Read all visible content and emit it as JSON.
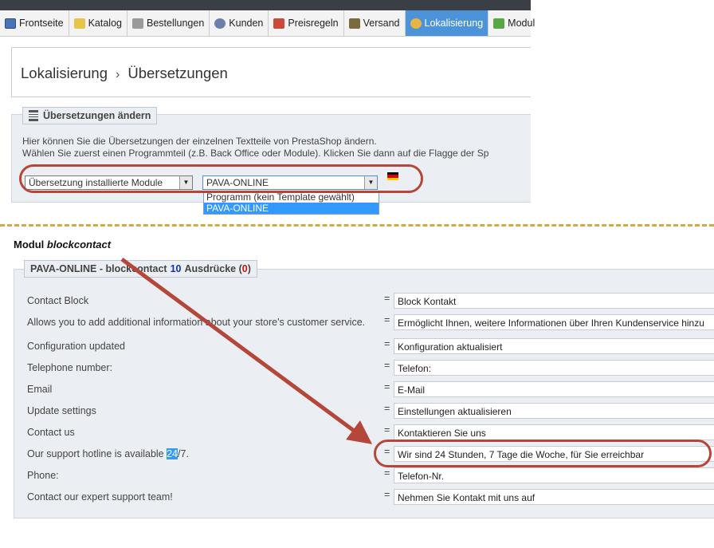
{
  "nav": {
    "tabs": [
      {
        "label": "Frontseite",
        "icon": "home-icon",
        "color": "#4a74b5"
      },
      {
        "label": "Katalog",
        "icon": "folder-icon",
        "color": "#e8c44a"
      },
      {
        "label": "Bestellungen",
        "icon": "cart-icon",
        "color": "#8a8a8a"
      },
      {
        "label": "Kunden",
        "icon": "user-icon",
        "color": "#6b7fae"
      },
      {
        "label": "Preisregeln",
        "icon": "price-tag-icon",
        "color": "#c94a3a"
      },
      {
        "label": "Versand",
        "icon": "truck-icon",
        "color": "#7a6a40"
      },
      {
        "label": "Lokalisierung",
        "icon": "globe-icon",
        "color": "#e6b640",
        "active": true
      },
      {
        "label": "Modul",
        "icon": "puzzle-icon",
        "color": "#55a845"
      }
    ]
  },
  "breadcrumb": {
    "parent": "Lokalisierung",
    "separator": "›",
    "current": "Übersetzungen"
  },
  "translations_panel": {
    "legend": "Übersetzungen ändern",
    "description_line1": "Hier können Sie die Übersetzungen der einzelnen Textteile von PrestaShop ändern.",
    "description_line2": "Wählen Sie zuerst einen Programmteil (z.B. Back Office oder Module). Klicken Sie dann auf die Flagge der Sp",
    "type_select_value": "Übersetzung installierte Module",
    "theme_select_value": "PAVA-ONLINE",
    "theme_options": [
      "Programm (kein Template gewählt)",
      "PAVA-ONLINE"
    ],
    "flag": "german-flag-icon"
  },
  "module": {
    "title_prefix": "Modul",
    "title_name": "blockcontact",
    "legend_theme": "PAVA-ONLINE",
    "legend_sep": "-",
    "legend_module": "blockcontact",
    "legend_count": "10",
    "legend_word": "Ausdrücke",
    "legend_missing": "0",
    "rows": [
      {
        "source": "Contact Block",
        "value": "Block Kontakt"
      },
      {
        "source": "Allows you to add additional information about your store's customer service.",
        "value": "Ermöglicht Ihnen, weitere Informationen über Ihren Kundenservice hinzu"
      },
      {
        "source": "Configuration updated",
        "value": "Konfiguration aktualisiert"
      },
      {
        "source": "Telephone number:",
        "value": "Telefon:"
      },
      {
        "source": "Email",
        "value": "E-Mail"
      },
      {
        "source": "Update settings",
        "value": "Einstellungen aktualisieren"
      },
      {
        "source": "Contact us",
        "value": "Kontaktieren Sie uns"
      },
      {
        "source_pre": "Our support hotline is available ",
        "source_mark": "24",
        "source_post": "/7.",
        "value": "Wir sind 24 Stunden, 7 Tage die Woche, für Sie erreichbar"
      },
      {
        "source": "Phone:",
        "value": "Telefon-Nr."
      },
      {
        "source": "Contact our expert support team!",
        "value": "Nehmen Sie Kontakt mit uns auf"
      }
    ],
    "equals": "="
  },
  "colors": {
    "highlight_oval": "#b5473a",
    "active_tab": "#4d93d9",
    "divider": "#d8a74a"
  }
}
